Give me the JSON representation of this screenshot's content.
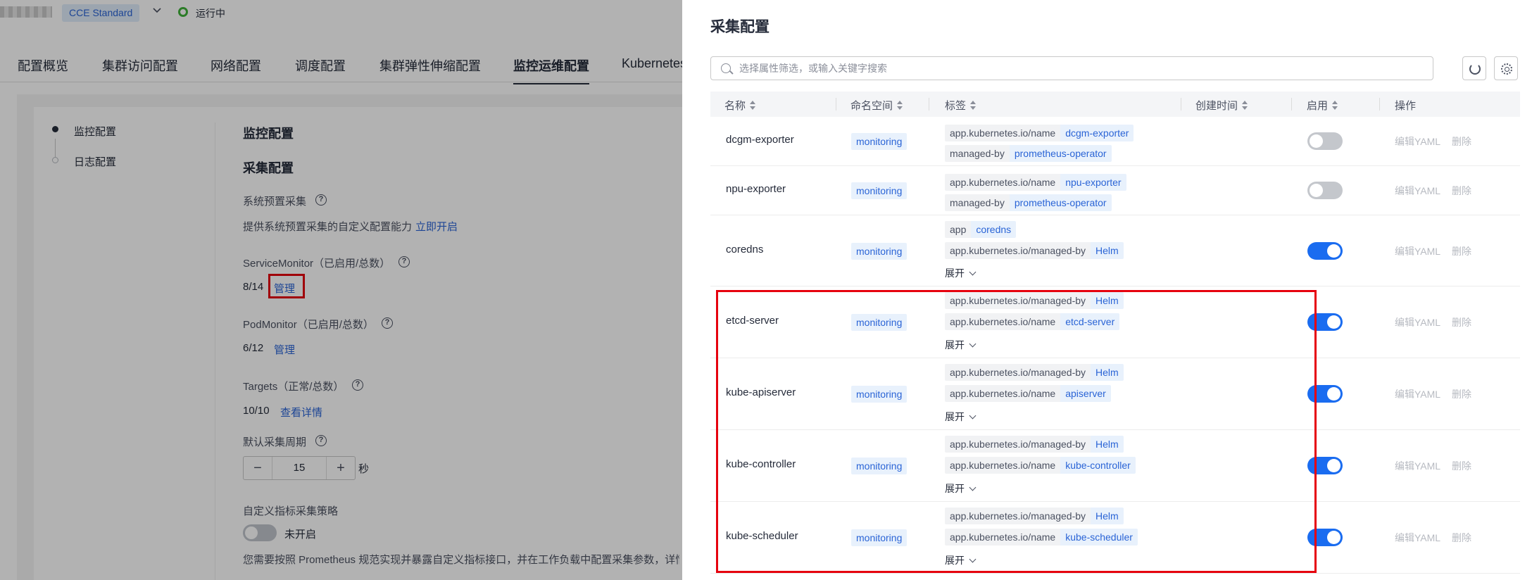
{
  "topbar": {
    "edition": "CCE Standard",
    "status": "运行中"
  },
  "tabs": [
    "配置概览",
    "集群访问配置",
    "网络配置",
    "调度配置",
    "集群弹性伸缩配置",
    "监控运维配置",
    "Kubernetes"
  ],
  "steps": [
    "监控配置",
    "日志配置"
  ],
  "monitor": {
    "title": "监控配置",
    "collect_title": "采集配置",
    "preset_label": "系统预置采集",
    "preset_desc": "提供系统预置采集的自定义配置能力",
    "preset_link": "立即开启",
    "service_monitor_label": "ServiceMonitor（已启用/总数）",
    "service_monitor_value": "8/14",
    "service_monitor_link": "管理",
    "pod_monitor_label": "PodMonitor（已启用/总数）",
    "pod_monitor_value": "6/12",
    "pod_monitor_link": "管理",
    "targets_label": "Targets（正常/总数）",
    "targets_value": "10/10",
    "targets_link": "查看详情",
    "period_label": "默认采集周期",
    "period_value": "15",
    "period_unit": "秒",
    "custom_label": "自定义指标采集策略",
    "custom_status": "未开启",
    "custom_desc": "您需要按照 Prometheus 规范实现并暴露自定义指标接口，并在工作负载中配置采集参数，详情"
  },
  "drawer": {
    "title": "采集配置",
    "search_placeholder": "选择属性筛选，或输入关键字搜索",
    "columns": [
      "名称",
      "命名空间",
      "标签",
      "创建时间",
      "启用",
      "操作"
    ],
    "expand_label": "展开",
    "op_edit": "编辑YAML",
    "op_delete": "删除",
    "rows": [
      {
        "name": "dcgm-exporter",
        "namespace": "monitoring",
        "enabled": false,
        "tags": [
          {
            "k": "app.kubernetes.io/name",
            "v": "dcgm-exporter"
          },
          {
            "k": "managed-by",
            "v": "prometheus-operator"
          }
        ]
      },
      {
        "name": "npu-exporter",
        "namespace": "monitoring",
        "enabled": false,
        "tags": [
          {
            "k": "app.kubernetes.io/name",
            "v": "npu-exporter"
          },
          {
            "k": "managed-by",
            "v": "prometheus-operator"
          }
        ]
      },
      {
        "name": "coredns",
        "namespace": "monitoring",
        "enabled": true,
        "tags": [
          {
            "k": "app",
            "v": "coredns"
          },
          {
            "k": "app.kubernetes.io/managed-by",
            "v": "Helm"
          }
        ]
      },
      {
        "name": "etcd-server",
        "namespace": "monitoring",
        "enabled": true,
        "tags": [
          {
            "k": "app.kubernetes.io/managed-by",
            "v": "Helm"
          },
          {
            "k": "app.kubernetes.io/name",
            "v": "etcd-server"
          }
        ]
      },
      {
        "name": "kube-apiserver",
        "namespace": "monitoring",
        "enabled": true,
        "tags": [
          {
            "k": "app.kubernetes.io/managed-by",
            "v": "Helm"
          },
          {
            "k": "app.kubernetes.io/name",
            "v": "apiserver"
          }
        ]
      },
      {
        "name": "kube-controller",
        "namespace": "monitoring",
        "enabled": true,
        "tags": [
          {
            "k": "app.kubernetes.io/managed-by",
            "v": "Helm"
          },
          {
            "k": "app.kubernetes.io/name",
            "v": "kube-controller"
          }
        ]
      },
      {
        "name": "kube-scheduler",
        "namespace": "monitoring",
        "enabled": true,
        "tags": [
          {
            "k": "app.kubernetes.io/managed-by",
            "v": "Helm"
          },
          {
            "k": "app.kubernetes.io/name",
            "v": "kube-scheduler"
          }
        ]
      }
    ]
  }
}
